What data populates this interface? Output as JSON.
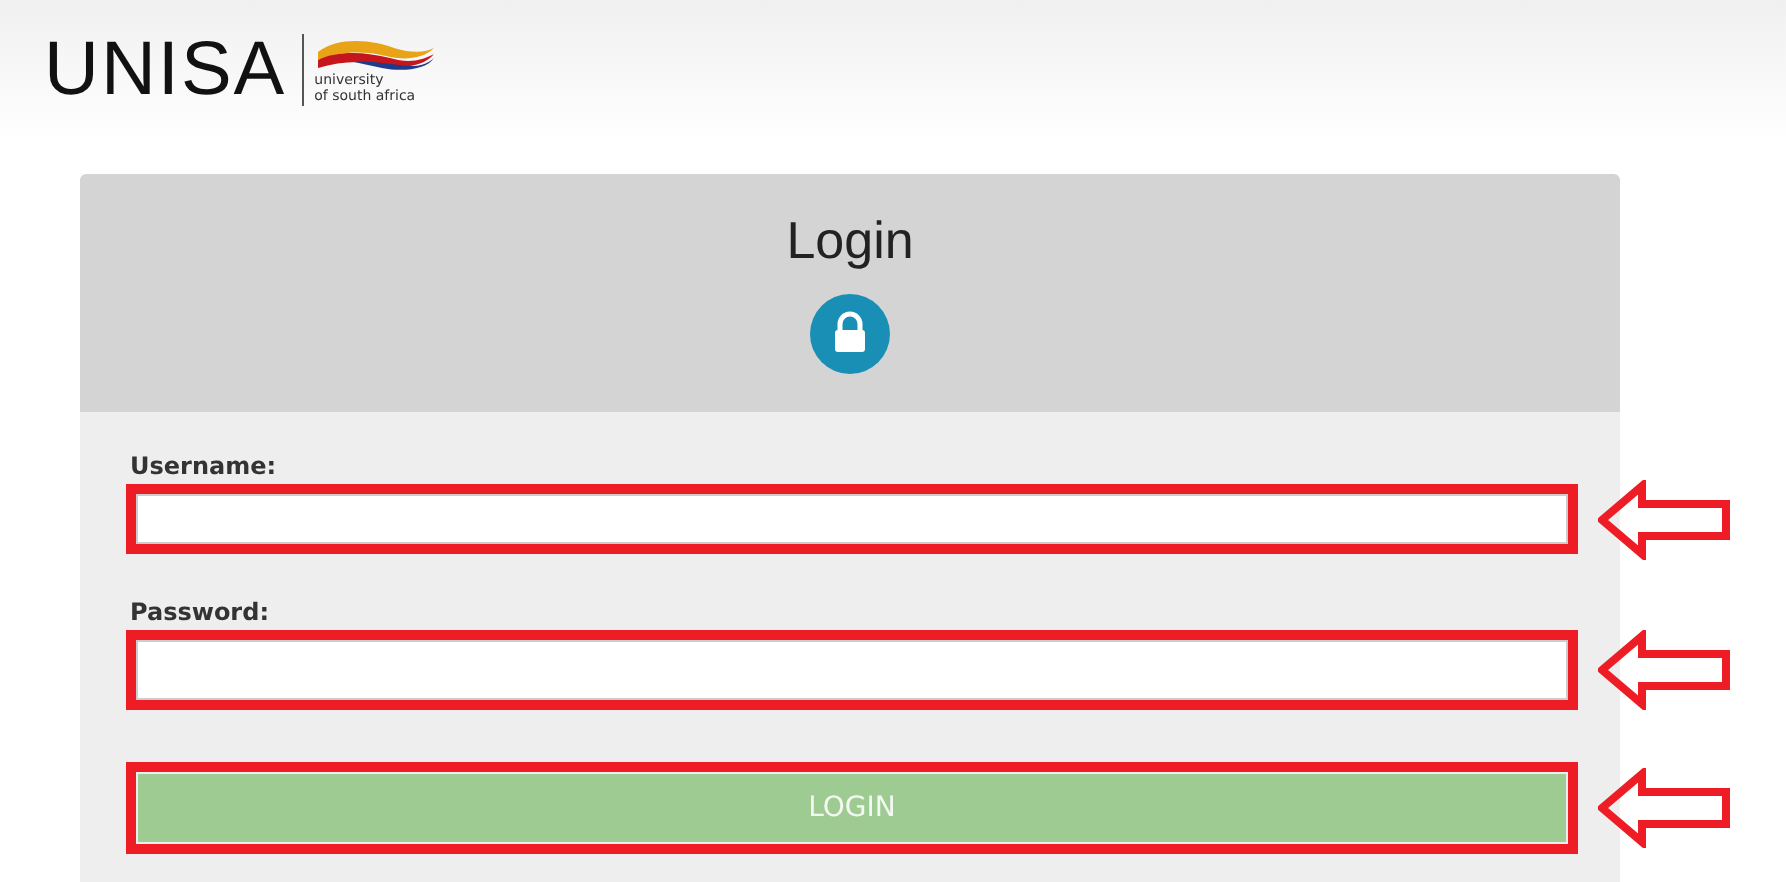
{
  "logo": {
    "wordmark": "UNISA",
    "tagline": [
      "university",
      "of south africa"
    ]
  },
  "login": {
    "title": "Login",
    "fields": [
      {
        "label": "Username:",
        "highlighted": true
      },
      {
        "label": "Password:",
        "highlighted": true
      }
    ],
    "button": {
      "label": "LOGIN",
      "highlighted": true
    }
  }
}
